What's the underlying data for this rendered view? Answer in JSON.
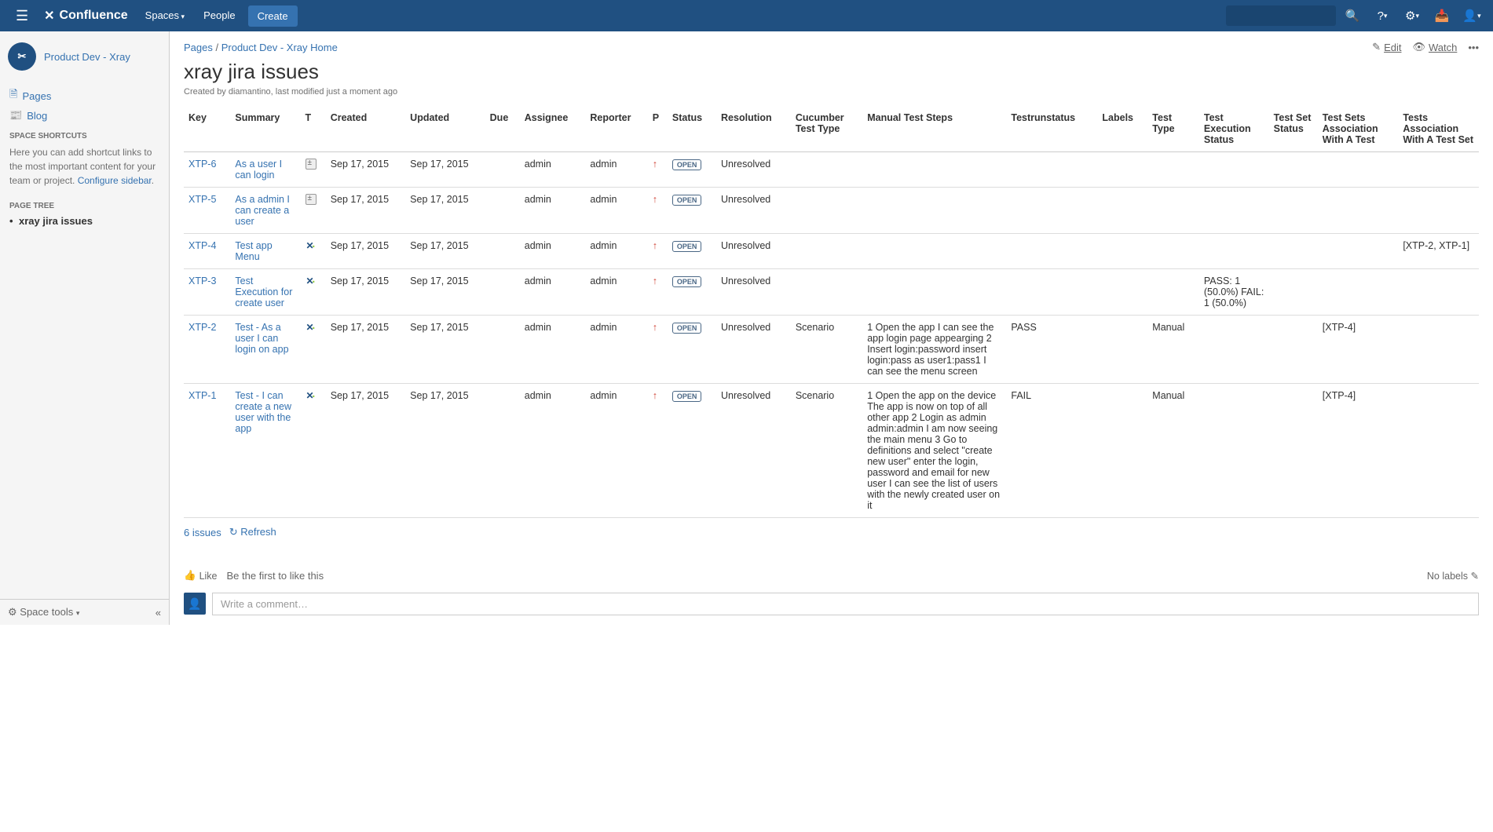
{
  "topnav": {
    "logo": "Confluence",
    "spaces": "Spaces",
    "people": "People",
    "create": "Create"
  },
  "sidebar": {
    "space_name": "Product Dev - Xray",
    "pages": "Pages",
    "blog": "Blog",
    "shortcuts_heading": "SPACE SHORTCUTS",
    "shortcuts_text": "Here you can add shortcut links to the most important content for your team or project. ",
    "configure_link": "Configure sidebar",
    "pagetree_heading": "PAGE TREE",
    "pagetree_item": "xray jira issues",
    "space_tools": "Space tools"
  },
  "breadcrumbs": {
    "pages": "Pages",
    "space_home": "Product Dev - Xray Home"
  },
  "page_actions": {
    "edit": "Edit",
    "watch": "Watch"
  },
  "title": "xray jira issues",
  "byline": "Created by diamantino, last modified just a moment ago",
  "columns": [
    "Key",
    "Summary",
    "T",
    "Created",
    "Updated",
    "Due",
    "Assignee",
    "Reporter",
    "P",
    "Status",
    "Resolution",
    "Cucumber Test Type",
    "Manual Test Steps",
    "Testrunstatus",
    "Labels",
    "Test Type",
    "Test Execution Status",
    "Test Set Status",
    "Test Sets Association With A Test",
    "Tests Association With A Test Set"
  ],
  "rows": [
    {
      "key": "XTP-6",
      "summary": "As a user I can login",
      "type": "story",
      "created": "Sep 17, 2015",
      "updated": "Sep 17, 2015",
      "due": "",
      "assignee": "admin",
      "reporter": "admin",
      "priority": "up",
      "status": "OPEN",
      "resolution": "Unresolved",
      "cucumber": "",
      "steps": "",
      "testrun": "",
      "labels": "",
      "testtype": "",
      "texec": "",
      "tset": "",
      "tsassoc": "",
      "tassoc": ""
    },
    {
      "key": "XTP-5",
      "summary": "As a admin I can create a user",
      "type": "story",
      "created": "Sep 17, 2015",
      "updated": "Sep 17, 2015",
      "due": "",
      "assignee": "admin",
      "reporter": "admin",
      "priority": "up",
      "status": "OPEN",
      "resolution": "Unresolved",
      "cucumber": "",
      "steps": "",
      "testrun": "",
      "labels": "",
      "testtype": "",
      "texec": "",
      "tset": "",
      "tsassoc": "",
      "tassoc": ""
    },
    {
      "key": "XTP-4",
      "summary": "Test app Menu",
      "type": "xray",
      "created": "Sep 17, 2015",
      "updated": "Sep 17, 2015",
      "due": "",
      "assignee": "admin",
      "reporter": "admin",
      "priority": "up",
      "status": "OPEN",
      "resolution": "Unresolved",
      "cucumber": "",
      "steps": "",
      "testrun": "",
      "labels": "",
      "testtype": "",
      "texec": "",
      "tset": "",
      "tsassoc": "",
      "tassoc": "[XTP-2, XTP-1]"
    },
    {
      "key": "XTP-3",
      "summary": "Test Execution for create user",
      "type": "xray",
      "created": "Sep 17, 2015",
      "updated": "Sep 17, 2015",
      "due": "",
      "assignee": "admin",
      "reporter": "admin",
      "priority": "up",
      "status": "OPEN",
      "resolution": "Unresolved",
      "cucumber": "",
      "steps": "",
      "testrun": "",
      "labels": "",
      "testtype": "",
      "texec": "PASS: 1 (50.0%) FAIL: 1 (50.0%)",
      "tset": "",
      "tsassoc": "",
      "tassoc": ""
    },
    {
      "key": "XTP-2",
      "summary": "Test - As a user I can login on app",
      "type": "xray",
      "created": "Sep 17, 2015",
      "updated": "Sep 17, 2015",
      "due": "",
      "assignee": "admin",
      "reporter": "admin",
      "priority": "up",
      "status": "OPEN",
      "resolution": "Unresolved",
      "cucumber": "Scenario",
      "steps": "1 Open the app I can see the app login page appearging 2 Insert login:password insert login:pass as user1:pass1 I can see the menu screen",
      "testrun": "PASS",
      "labels": "",
      "testtype": "Manual",
      "texec": "",
      "tset": "",
      "tsassoc": "[XTP-4]",
      "tassoc": ""
    },
    {
      "key": "XTP-1",
      "summary": "Test - I can create a new user with the app",
      "type": "xray",
      "created": "Sep 17, 2015",
      "updated": "Sep 17, 2015",
      "due": "",
      "assignee": "admin",
      "reporter": "admin",
      "priority": "up",
      "status": "OPEN",
      "resolution": "Unresolved",
      "cucumber": "Scenario",
      "steps": "1 Open the app on the device The app is now on top of all other app 2 Login as admin admin:admin I am now seeing the main menu 3 Go to definitions and select \"create new user\" enter the login, password and email for new user I can see the list of users with the newly created user on it",
      "testrun": "FAIL",
      "labels": "",
      "testtype": "Manual",
      "texec": "",
      "tset": "",
      "tsassoc": "[XTP-4]",
      "tassoc": ""
    }
  ],
  "count": "6 issues",
  "refresh": "Refresh",
  "like": "Like",
  "like_info": "Be the first to like this",
  "no_labels": "No labels",
  "comment_placeholder": "Write a comment…"
}
